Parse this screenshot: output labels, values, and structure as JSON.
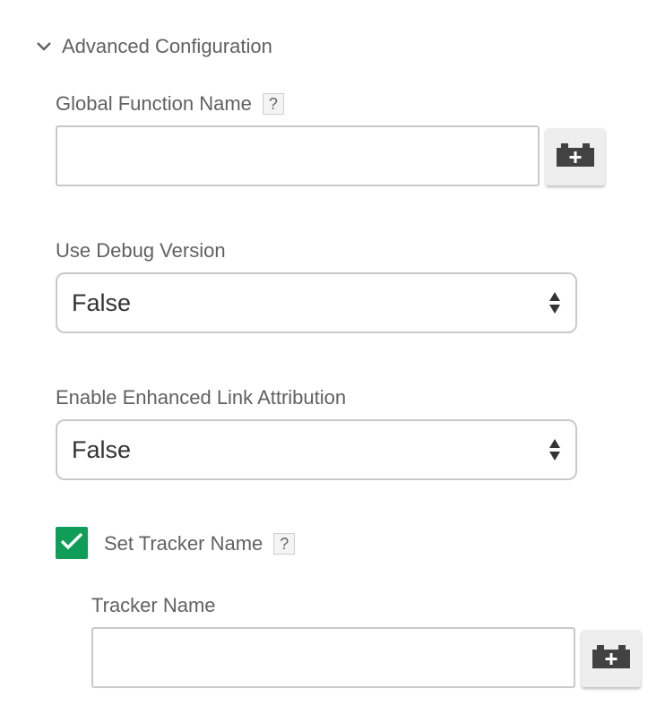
{
  "section": {
    "title": "Advanced Configuration",
    "icon": "chevron-down-icon"
  },
  "global_function_name": {
    "label": "Global Function Name",
    "help": "?",
    "value": ""
  },
  "use_debug_version": {
    "label": "Use Debug Version",
    "selected": "False"
  },
  "enhanced_link_attribution": {
    "label": "Enable Enhanced Link Attribution",
    "selected": "False"
  },
  "set_tracker_name": {
    "label": "Set Tracker Name",
    "help": "?",
    "checked": true
  },
  "tracker_name": {
    "label": "Tracker Name",
    "value": ""
  },
  "icons": {
    "variable_button": "add-variable-icon",
    "select_arrows": "sort-arrows-icon",
    "checkmark": "checkmark-icon"
  },
  "colors": {
    "checkbox": "#0f9d58"
  }
}
